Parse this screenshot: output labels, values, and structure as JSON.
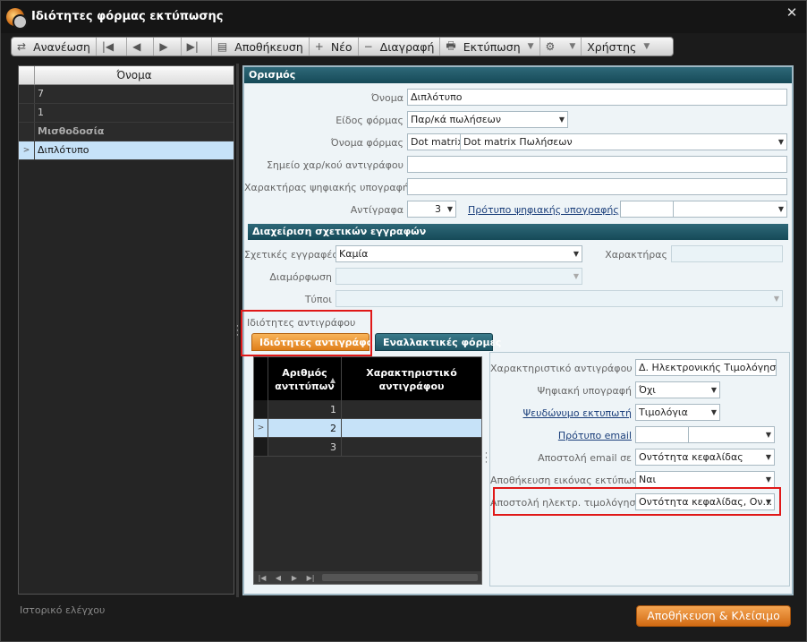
{
  "window": {
    "title": "Ιδιότητες φόρμας εκτύπωσης"
  },
  "toolbar": {
    "refresh": "Ανανέωση",
    "save": "Αποθήκευση",
    "new": "Νέο",
    "delete": "Διαγραφή",
    "print": "Εκτύπωση",
    "user": "Χρήστης"
  },
  "left_list": {
    "header": "Όνομα",
    "rows": [
      "7",
      "1",
      "Μισθοδοσία",
      "Διπλότυπο"
    ]
  },
  "definition": {
    "header": "Ορισμός",
    "name_label": "Όνομα",
    "name_value": "Διπλότυπο",
    "form_type_label": "Είδος φόρμας",
    "form_type_value": "Παρ/κά πωλήσεων",
    "form_name_label": "Όνομα φόρμας",
    "form_name_value1": "Dot matrix",
    "form_name_value2": "Dot matrix Πωλήσεων",
    "copy_mark_label": "Σημείο χαρ/κού αντιγράφου",
    "digital_sig_char_label": "Χαρακτήρας ψηφιακής υπογραφής",
    "copies_label": "Αντίγραφα",
    "copies_value": "3",
    "digital_sig_template_label": "Πρότυπο ψηφιακής υπογραφής"
  },
  "related": {
    "header": "Διαχείριση σχετικών εγγραφών",
    "records_label": "Σχετικές εγγραφές",
    "records_value": "Καμία",
    "char_label": "Χαρακτήρας",
    "config_label": "Διαμόρφωση",
    "types_label": "Τύποι"
  },
  "copy_props": {
    "section_label": "Ιδιότητες αντιγράφου",
    "tab_active": "Ιδιότητες αντιγράφου",
    "tab_other": "Εναλλακτικές φόρμες",
    "grid_col1": "Αριθμός αντιτύπων",
    "grid_col2": "Χαρακτηριστικό αντιγράφου",
    "grid_rows": [
      "1",
      "2",
      "3"
    ],
    "copy_char_label": "Χαρακτηριστικό αντιγράφου",
    "copy_char_value": "Δ. Ηλεκτρονικής Τιμολόγησης",
    "digital_sig_label": "Ψηφιακή υπογραφή",
    "digital_sig_value": "Όχι",
    "pseudo_printer_label": "Ψευδώνυμο εκτυπωτή",
    "pseudo_printer_value": "Τιμολόγια",
    "email_template_label": "Πρότυπο email",
    "send_email_label": "Αποστολή email σε",
    "send_email_value": "Οντότητα κεφαλίδας",
    "save_image_label": "Αποθήκευση εικόνας εκτύπωσης",
    "save_image_value": "Ναι",
    "einvoice_label": "Αποστολή ηλεκτρ. τιμολόγησης",
    "einvoice_value": "Οντότητα κεφαλίδας, Ον..."
  },
  "footer": {
    "history": "Ιστορικό ελέγχου",
    "save_close": "Αποθήκευση & Κλείσιμο"
  }
}
